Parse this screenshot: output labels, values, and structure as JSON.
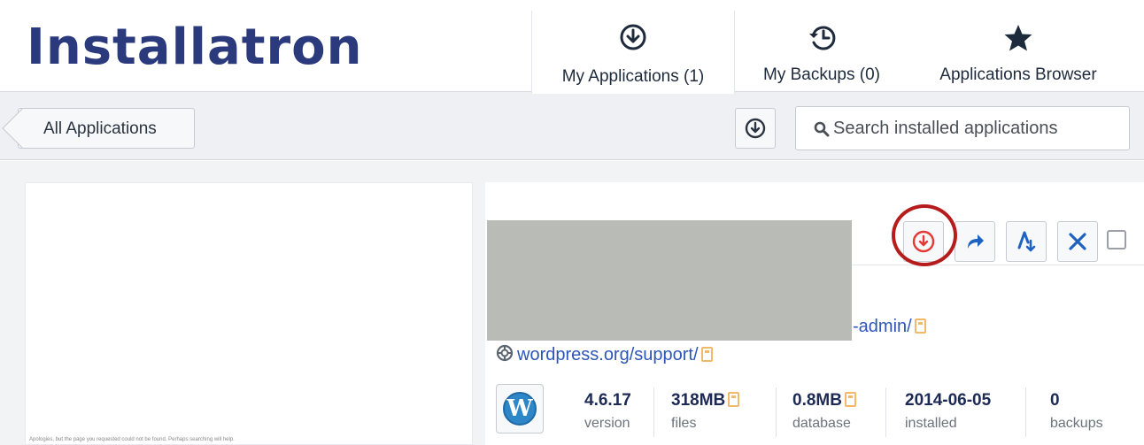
{
  "app": {
    "logo_text": "Installatron"
  },
  "nav": {
    "tabs": [
      {
        "label": "My Applications (1)",
        "icon": "download-circle-icon"
      },
      {
        "label": "My Backups (0)",
        "icon": "history-clock-icon"
      },
      {
        "label": "Applications Browser",
        "icon": "star-icon"
      }
    ]
  },
  "toolbar": {
    "back_label": "All Applications",
    "download_icon": "download-circle-icon",
    "search": {
      "placeholder": "Search installed applications",
      "value": ""
    }
  },
  "preview": {
    "caption": "Apologies, but the page you requested could not be found. Perhaps searching will help."
  },
  "actions": {
    "download": "download-backup-icon",
    "clone": "share-arrow-icon",
    "restore": "restore-icon",
    "delete": "close-x-icon"
  },
  "links": {
    "admin_suffix": "-admin/",
    "support": "wordpress.org/support/"
  },
  "stats": [
    {
      "value": "4.6.17",
      "caption": "version",
      "has_link": false
    },
    {
      "value": "318MB",
      "caption": "files",
      "has_link": true
    },
    {
      "value": "0.8MB",
      "caption": "database",
      "has_link": true
    },
    {
      "value": "2014-06-05",
      "caption": "installed",
      "has_link": false
    },
    {
      "value": "0",
      "caption": "backups",
      "has_link": false
    }
  ],
  "colors": {
    "brand": "#2a3a7c",
    "link": "#2d56b8",
    "action_icon": "#1f63c2",
    "download_red": "#e53935",
    "highlight": "#b71c1c",
    "redaction": "#b8bbb6"
  }
}
